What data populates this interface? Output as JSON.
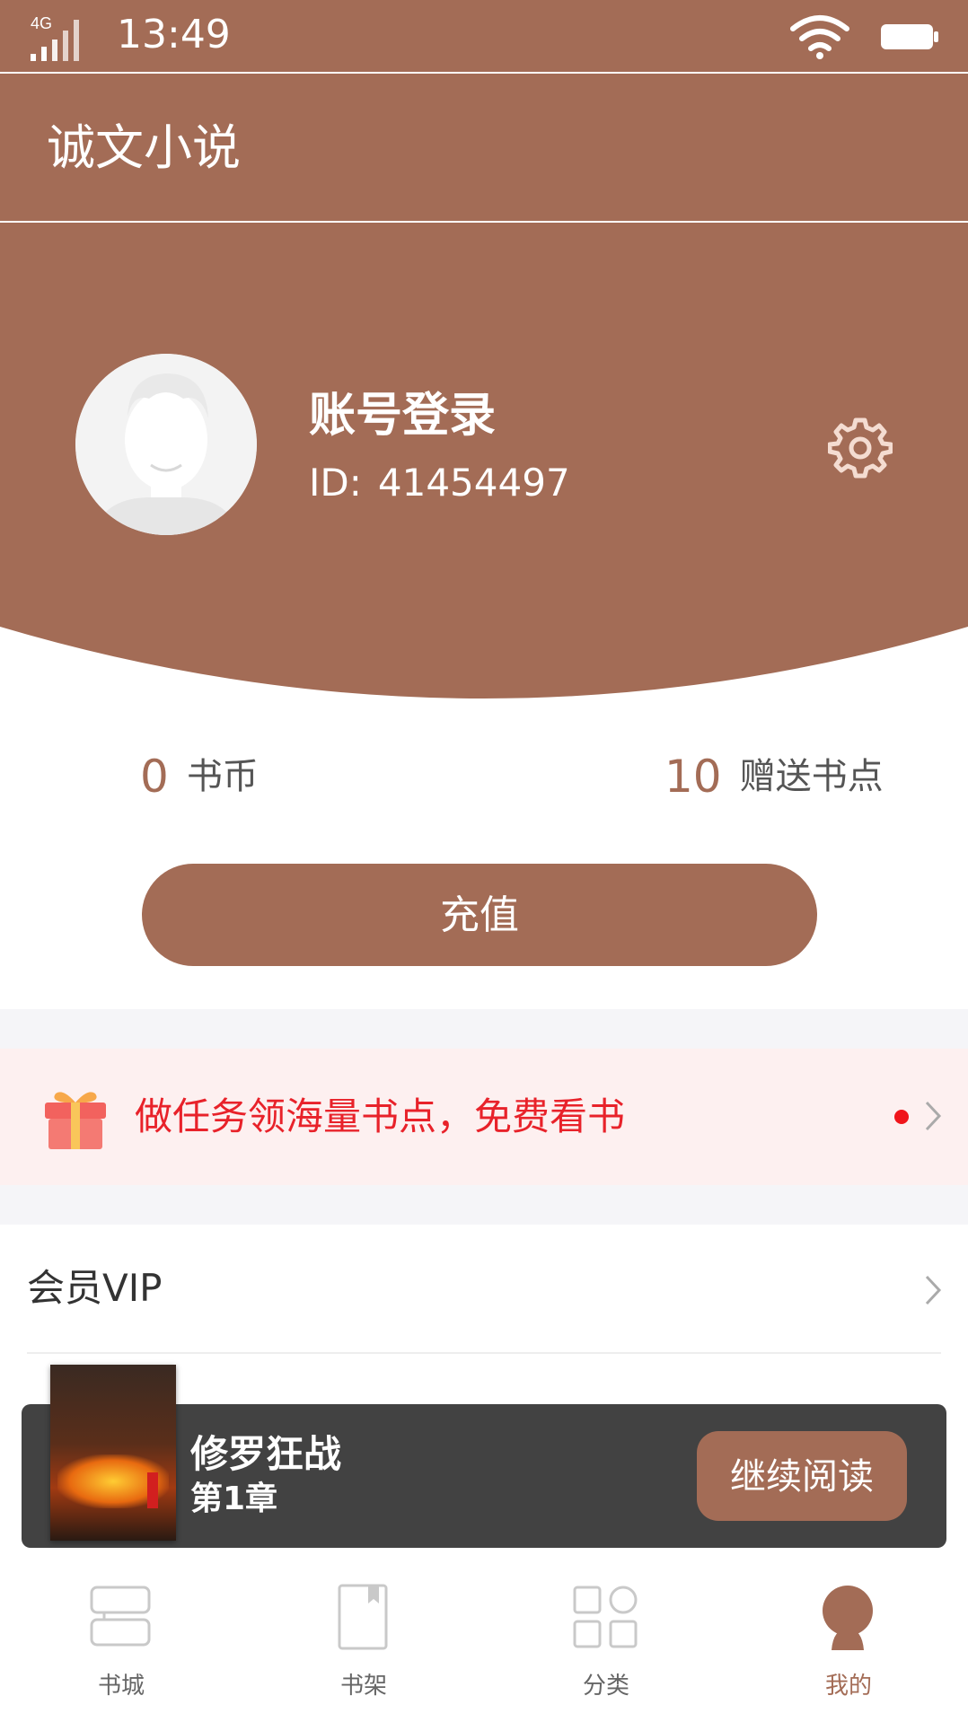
{
  "status_bar": {
    "network": "4G",
    "time": "13:49"
  },
  "header": {
    "title": "诚文小说"
  },
  "profile": {
    "login_label": "账号登录",
    "id_label": "ID:",
    "id_value": "41454497"
  },
  "balance": {
    "coins_value": "0",
    "coins_label": "书币",
    "points_value": "10",
    "points_label": "赠送书点"
  },
  "recharge_label": "充值",
  "task_banner": {
    "text": "做任务领海量书点，免费看书"
  },
  "menu": {
    "items": [
      {
        "label": "会员VIP"
      }
    ]
  },
  "continue_reading": {
    "book_title": "修罗狂战",
    "chapter": "第1章",
    "button_label": "继续阅读"
  },
  "tabs": [
    {
      "label": "书城",
      "icon": "bookstore-icon"
    },
    {
      "label": "书架",
      "icon": "bookshelf-icon"
    },
    {
      "label": "分类",
      "icon": "category-icon"
    },
    {
      "label": "我的",
      "icon": "profile-icon",
      "active": true
    }
  ],
  "colors": {
    "accent": "#a36c56",
    "task_text": "#e8222a",
    "background": "#ffffff"
  }
}
